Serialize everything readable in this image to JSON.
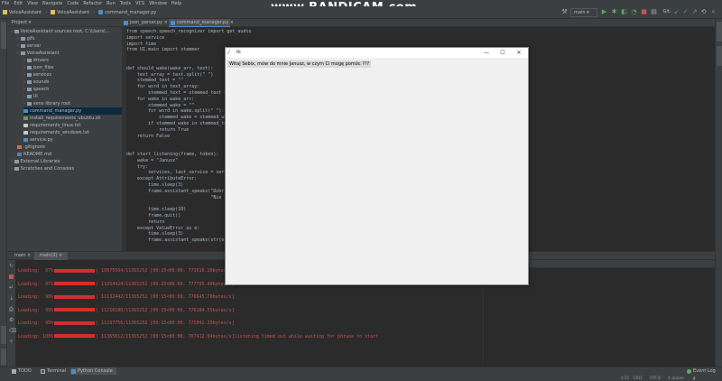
{
  "menu": [
    "File",
    "Edit",
    "View",
    "Navigate",
    "Code",
    "Refactor",
    "Run",
    "Tools",
    "VCS",
    "Window",
    "Help"
  ],
  "watermark": "www.BANDICAM.com",
  "breadcrumbs": [
    "VoiceAssistant",
    "VoiceAssistant",
    "command_manager.py"
  ],
  "run_config": "main",
  "git_label": "Git:",
  "tabs": [
    "json_parser.py",
    "command_manager.py"
  ],
  "project": {
    "header": "Project",
    "items": [
      {
        "label": "VoiceAssistant  sources root, C:\\Users\\...",
        "icon": "folder",
        "depth": 0
      },
      {
        "label": "gifs",
        "icon": "folder",
        "depth": 1
      },
      {
        "label": "server",
        "icon": "folder",
        "depth": 1
      },
      {
        "label": "VoiceAssistant",
        "icon": "folder",
        "depth": 1
      },
      {
        "label": "drivers",
        "icon": "folder",
        "depth": 2
      },
      {
        "label": "json_files",
        "icon": "folder",
        "depth": 2
      },
      {
        "label": "services",
        "icon": "folder",
        "depth": 2
      },
      {
        "label": "sounds",
        "icon": "folder",
        "depth": 2
      },
      {
        "label": "speech",
        "icon": "folder",
        "depth": 2
      },
      {
        "label": "UI",
        "icon": "folder",
        "depth": 2
      },
      {
        "label": "venv  library root",
        "icon": "folder",
        "depth": 2
      },
      {
        "label": "command_manager.py",
        "icon": "pyf",
        "depth": 2
      },
      {
        "label": "install_requirements_ubuntu.sh",
        "icon": "sh",
        "depth": 2
      },
      {
        "label": "requirements_linux.txt",
        "icon": "txt",
        "depth": 2
      },
      {
        "label": "requirements_windows.txt",
        "icon": "txt",
        "depth": 2
      },
      {
        "label": "service.py",
        "icon": "pyf",
        "depth": 2
      },
      {
        "label": ".gitignore",
        "icon": "git",
        "depth": 1
      },
      {
        "label": "README.md",
        "icon": "md",
        "depth": 1
      },
      {
        "label": "External Libraries",
        "icon": "lib",
        "depth": 0
      },
      {
        "label": "Scratches and Consoles",
        "icon": "lib",
        "depth": 0
      }
    ]
  },
  "code": [
    "from speech.speech_recognizer import get_audio",
    "import service",
    "import time",
    "from UI.main import stemmer",
    "",
    "",
    "def should_wake(wake_arr, text):",
    "    text_array = text.split(\" \")",
    "    stemmed_text = \"\"",
    "    for word in text_array:",
    "        stemmed_text = stemmed_text + ",
    "    for wake in wake_arr:",
    "        stemmed_wake = \"\"",
    "        for word in wake.split(\" \"):",
    "            stemmed_wake = stemmed_wak",
    "        if stemmed_wake in stemmed_tex",
    "            return True",
    "    return False",
    "",
    "",
    "def start_listening(frame, token):",
    "    wake = \"Janusz\"",
    "    try:",
    "        services, last_service = servi",
    "    except AttributeError:",
    "        time.sleep(3)",
    "        frame.assistant_speaks(\"Dobr",
    "                               \"Nie kon",
    "",
    "        time.sleep(10)",
    "        frame.quit()",
    "        return",
    "    except ValueError as e:",
    "        time.sleep(3)",
    "        frame.assistant_speaks(str(e))"
  ],
  "run": {
    "tabs": [
      "main",
      "main(2)"
    ],
    "lines": [
      {
        "prefix": "Loading:  97%",
        "suffix": "| 10975564/11365252 [00:15<00:00, 773010.26bytes/s]"
      },
      {
        "prefix": "Loading:  97%",
        "suffix": "| 11054424/11365252 [00:15<00:00, 777705.40bytes/s]"
      },
      {
        "prefix": "Loading:  98%",
        "suffix": "| 11132442/11365252 [00:15<00:00, 776645.76bytes/s]"
      },
      {
        "prefix": "Loading:  99%",
        "suffix": "| 11210180/11365252 [00:15<00:00, 776184.55bytes/s]"
      },
      {
        "prefix": "Loading:  99%",
        "suffix": "| 11287756/11365252 [00:15<00:00, 775042.39bytes/s]"
      },
      {
        "prefix": "Loading: 100%",
        "suffix": "| 11365012/11365252 [00:15<00:00, 767412.94bytes/s]listening timed out while waiting for phrase to start"
      }
    ]
  },
  "bottom_tabs": [
    "TODO",
    "Terminal",
    "Python Console"
  ],
  "status": {
    "position": "4:15",
    "line_sep": "CRLF",
    "encoding": "UTF-8",
    "indent": "4 spaces",
    "event_log": "Event Log"
  },
  "tk": {
    "title": "tk",
    "message": "Witaj Sebix, mów do mnie Janusz, w czym Ci mogę pomóc ???"
  },
  "colors": {
    "progress": "#d23030",
    "selection": "#0d293e",
    "accent": "#4a88c7"
  }
}
